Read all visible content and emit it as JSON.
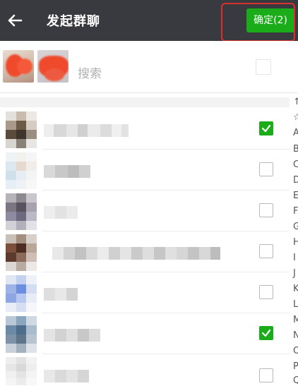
{
  "header": {
    "back_icon": "arrow-left-icon",
    "title": "发起群聊",
    "confirm_label": "确定(2)"
  },
  "search": {
    "placeholder": "搜索",
    "icon": "search-icon"
  },
  "contacts": [
    {
      "checked": true
    },
    {
      "checked": false
    },
    {
      "checked": false
    },
    {
      "checked": false
    },
    {
      "checked": false
    },
    {
      "checked": true
    },
    {
      "checked": false
    }
  ],
  "index_letters": [
    "↑",
    "☆",
    "A",
    "B",
    "C",
    "D",
    "E",
    "F",
    "G",
    "H",
    "I",
    "J",
    "K",
    "L",
    "M",
    "N",
    "O",
    "P",
    "Q"
  ],
  "colors": {
    "topbar": "#393a3f",
    "confirm_button": "#1aad19",
    "highlight_border": "#d9312f",
    "checkbox_on": "#1aad19"
  }
}
